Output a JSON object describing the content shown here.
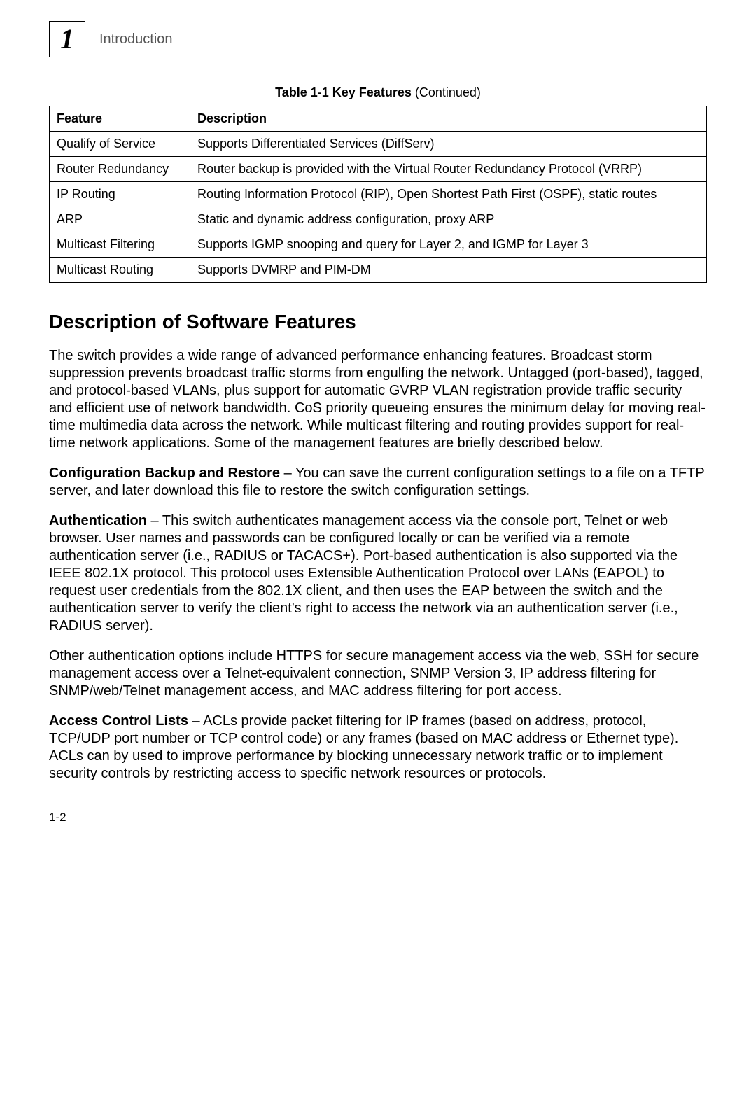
{
  "header": {
    "chapter_number": "1",
    "title": "Introduction"
  },
  "table": {
    "caption_bold": "Table 1-1  Key Features",
    "caption_rest": " (Continued)",
    "col1": "Feature",
    "col2": "Description",
    "rows": [
      {
        "feature": "Qualify of Service",
        "desc": "Supports Differentiated Services (DiffServ)"
      },
      {
        "feature": "Router Redundancy",
        "desc": "Router backup is provided with the Virtual Router Redundancy Protocol (VRRP)"
      },
      {
        "feature": "IP Routing",
        "desc": "Routing Information Protocol (RIP), Open Shortest Path First (OSPF), static routes"
      },
      {
        "feature": "ARP",
        "desc": "Static and dynamic address configuration, proxy ARP"
      },
      {
        "feature": "Multicast Filtering",
        "desc": "Supports IGMP snooping and query for Layer 2, and IGMP for Layer 3"
      },
      {
        "feature": "Multicast Routing",
        "desc": "Supports DVMRP and PIM-DM"
      }
    ]
  },
  "section_heading": "Description of Software Features",
  "paragraphs": {
    "intro": "The switch provides a wide range of advanced performance enhancing features. Broadcast storm suppression prevents broadcast traffic storms from engulfing the network. Untagged (port-based), tagged, and protocol-based VLANs, plus support for automatic GVRP VLAN registration provide traffic security and efficient use of network bandwidth. CoS priority queueing ensures the minimum delay for moving real-time multimedia data across the network. While multicast filtering and routing provides support for real-time network applications. Some of the management features are briefly described below.",
    "backup_lead": "Configuration Backup and Restore",
    "backup_rest": " – You can save the current configuration settings to a file on a TFTP server, and later download this file to restore the switch configuration settings.",
    "auth_lead": "Authentication",
    "auth_rest": " – This switch authenticates management access via the console port, Telnet or web browser. User names and passwords can be configured locally or can be verified via a remote authentication server (i.e., RADIUS or TACACS+). Port-based authentication is also supported via the IEEE 802.1X protocol. This protocol uses Extensible Authentication Protocol over LANs (EAPOL) to request user credentials from the 802.1X client, and then uses the EAP between the switch and the authentication server to verify the client's right to access the network via an authentication server (i.e., RADIUS server).",
    "auth_other": "Other authentication options include HTTPS for secure management access via the web, SSH for secure management access over a Telnet-equivalent connection, SNMP Version 3, IP address filtering for SNMP/web/Telnet management access, and MAC address filtering for port access.",
    "acl_lead": "Access Control Lists",
    "acl_rest": " – ACLs provide packet filtering for IP frames (based on address, protocol, TCP/UDP port number or TCP control code) or any frames (based on MAC address or Ethernet type). ACLs can by used to improve performance by blocking unnecessary network traffic or to implement security controls by restricting access to specific network resources or protocols."
  },
  "page_number": "1-2"
}
